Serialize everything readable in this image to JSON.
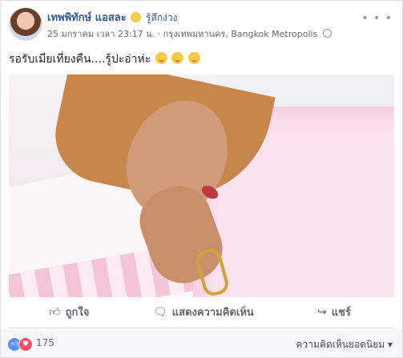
{
  "post": {
    "author": "เทพพิทักษ์ แอสละ",
    "feeling": "รู้สึกง่วง",
    "timestamp": "25 มกราคม เวลา 23:17 น.",
    "location": "กรุงเทพมหานคร, Bangkok Metropolis",
    "text": "รอรับเมียเที่ยงคืน....รู้ปะอ่าห่ะ",
    "more_icon_text": "• • •"
  },
  "actions": {
    "like_label": "ถูกใจ",
    "comment_label": "แสดงความคิดเห็น",
    "share_label": "แชร์"
  },
  "footer": {
    "reaction_count": "175",
    "sort_label": "ความคิดเห็นยอดนิยม ▾"
  },
  "icons": {
    "like": "thumb-up-outline-icon",
    "comment": "speech-bubble-icon",
    "share": "share-arrow-icon",
    "reaction_like": "like-reaction-icon",
    "reaction_love": "love-reaction-icon"
  }
}
